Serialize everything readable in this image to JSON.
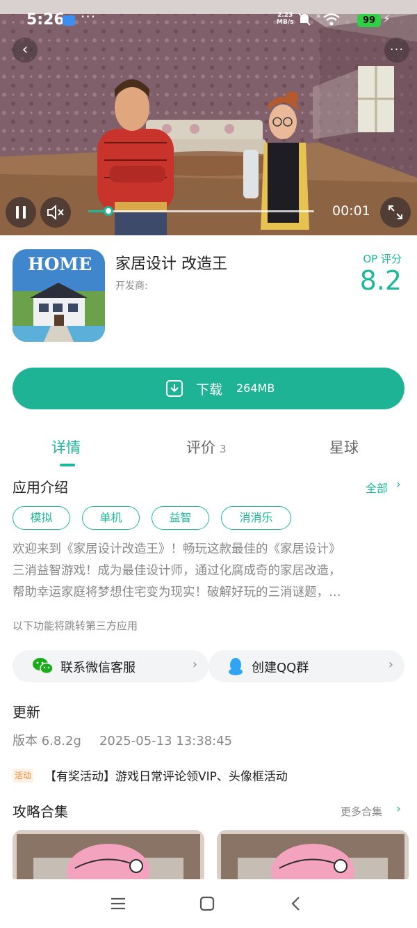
{
  "status_bar": {
    "time": "5:26",
    "overflow_dots": "···",
    "net_speed": "2.23",
    "net_speed_unit": "MB/s",
    "battery": "99",
    "icons": [
      "mail-icon",
      "mute-bell-icon",
      "no-sim-icon",
      "wifi-icon",
      "charging-icon"
    ]
  },
  "video": {
    "back_glyph": "‹",
    "more_glyph": "···",
    "elapsed": "00:01",
    "progress": 0.09
  },
  "app": {
    "title": "家居设计 改造王",
    "developer_label": "开发商:",
    "score_label": "OP 评分",
    "score": "8.2",
    "icon_text": "HOME"
  },
  "download": {
    "label": "下载",
    "size": "264MB"
  },
  "tabs": [
    {
      "label": "详情",
      "active": true
    },
    {
      "label": "评价",
      "count": "3"
    },
    {
      "label": "星球"
    }
  ],
  "intro": {
    "title": "应用介绍",
    "see_all": "全部",
    "tags": [
      "模拟",
      "单机",
      "益智",
      "消消乐"
    ],
    "description_lines": [
      "欢迎来到《家居设计改造王》！畅玩这款最佳的《家居设计》",
      "三消益智游戏！成为最佳设计师，通过化腐成奇的家居改造，",
      "帮助幸运家庭将梦想住宅变为现实！破解好玩的三消谜题，…"
    ],
    "third_party_note": "以下功能将跳转第三方应用"
  },
  "links": [
    {
      "label": "联系微信客服"
    },
    {
      "label": "创建QQ群"
    }
  ],
  "update": {
    "title": "更新",
    "version": "版本 6.8.2g",
    "date": "2025-05-13 13:38:45"
  },
  "event": {
    "badge": "活动",
    "text": "【有奖活动】游戏日常评论领VIP、头像框活动"
  },
  "guides": {
    "title": "攻略合集",
    "more": "更多合集"
  },
  "colors": {
    "accent": "#1cb89a",
    "event_badge": "#f08a2f"
  }
}
